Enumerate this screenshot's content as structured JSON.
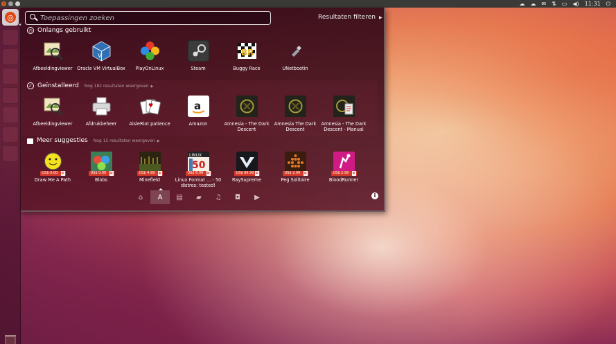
{
  "top_panel": {
    "window_buttons": [
      "close",
      "minimize",
      "maximize"
    ],
    "indicators": [
      {
        "icon": "cloud-icon",
        "glyph": "☁"
      },
      {
        "icon": "cloud-sync-icon",
        "glyph": "☁"
      },
      {
        "icon": "mail-icon",
        "glyph": "✉"
      },
      {
        "icon": "network-icon",
        "glyph": "⇅"
      },
      {
        "icon": "battery-icon",
        "glyph": "▭"
      },
      {
        "icon": "volume-icon",
        "glyph": "◀)"
      }
    ],
    "clock": "11:31",
    "power_glyph": "⏻"
  },
  "launcher": {
    "home_glyph": "◎",
    "items": [
      "firefox",
      "files",
      "libreoffice-writer",
      "libreoffice-calc",
      "libreoffice-impress",
      "software-center",
      "settings"
    ]
  },
  "dash": {
    "search": {
      "placeholder": "Toepassingen zoeken",
      "value": ""
    },
    "filter_label": "Resultaten filteren",
    "sections": [
      {
        "title": "Onlangs gebruikt",
        "subtitle": "",
        "apps": [
          {
            "label": "Afbeeldingviewer",
            "icon": "image-viewer-icon"
          },
          {
            "label": "Oracle VM VirtualBox",
            "icon": "virtualbox-icon"
          },
          {
            "label": "PlayOnLinux",
            "icon": "playonlinux-icon"
          },
          {
            "label": "Steam",
            "icon": "steam-icon"
          },
          {
            "label": "Buggy Race",
            "icon": "buggy-race-icon"
          },
          {
            "label": "UNetbootin",
            "icon": "unetbootin-icon"
          }
        ]
      },
      {
        "title": "Geïnstalleerd",
        "subtitle": "Nog 182 resultaten weergeven",
        "apps": [
          {
            "label": "Afbeeldingviewer",
            "icon": "image-viewer-icon"
          },
          {
            "label": "Afdrukbeheer",
            "icon": "printer-icon"
          },
          {
            "label": "AisleRiot patience",
            "icon": "cards-icon"
          },
          {
            "label": "Amazon",
            "icon": "amazon-icon"
          },
          {
            "label": "Amnesia - The Dark Descent",
            "icon": "amnesia-icon"
          },
          {
            "label": "Amnesia The Dark Descent",
            "icon": "amnesia-icon"
          },
          {
            "label": "Amnesia - The Dark Descent - Manual",
            "icon": "amnesia-manual-icon"
          }
        ]
      },
      {
        "title": "Meer suggesties",
        "subtitle": "Nog 15 resultaten weergeven",
        "apps": [
          {
            "label": "Draw Me A Path",
            "icon": "smiley-icon",
            "price": "US$ 0.00"
          },
          {
            "label": "Blobs",
            "icon": "blobs-icon",
            "price": "US$ 0.00"
          },
          {
            "label": "Minefield",
            "icon": "minefield-icon",
            "price": "US$ 4.99"
          },
          {
            "label": "Linux Format ... - 50 distros: tested!",
            "icon": "linux-format-icon",
            "price": "US$ 6.99"
          },
          {
            "label": "RaySupreme",
            "icon": "raysupreme-icon",
            "price": "US$ 99.99"
          },
          {
            "label": "Peg Solitaire",
            "icon": "peg-solitaire-icon",
            "price": "US$ 2.99"
          },
          {
            "label": "BloodRunner",
            "icon": "bloodrunner-icon",
            "price": "US$ 2.99"
          }
        ]
      }
    ],
    "lenses": [
      {
        "name": "home-lens",
        "glyph": "⌂"
      },
      {
        "name": "applications-lens",
        "glyph": "A",
        "active": true
      },
      {
        "name": "files-lens",
        "glyph": "▤"
      },
      {
        "name": "social-lens",
        "glyph": "▰"
      },
      {
        "name": "music-lens",
        "glyph": "♫"
      },
      {
        "name": "photos-lens",
        "glyph": "◘"
      },
      {
        "name": "video-lens",
        "glyph": "▶"
      }
    ],
    "info_glyph": "i"
  }
}
